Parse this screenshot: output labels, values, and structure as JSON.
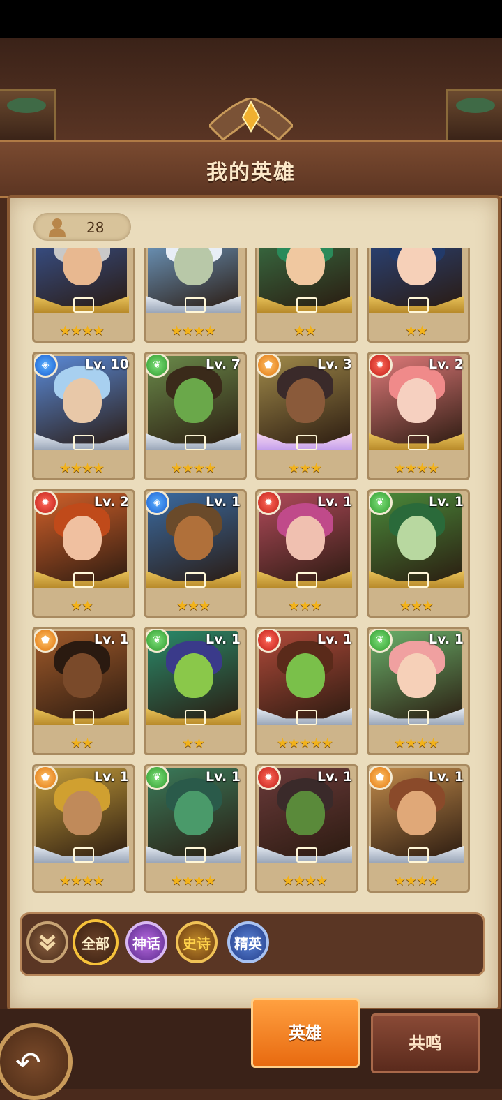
{
  "title": "我的英雄",
  "hero_count": "28",
  "filters": {
    "all": "全部",
    "mythic": "神话",
    "epic": "史诗",
    "elite": "精英"
  },
  "tabs": {
    "heroes": "英雄",
    "resonance": "共鸣"
  },
  "colors": {
    "accent_gold": "#f2b21a",
    "tab_active": "#f08020",
    "paper": "#eadcbc"
  },
  "heroes": [
    {
      "level": "",
      "element": "",
      "stars": "★★★★",
      "rarity": "gold"
    },
    {
      "level": "",
      "element": "",
      "stars": "★★★★",
      "rarity": "silver"
    },
    {
      "level": "",
      "element": "",
      "stars": "★★",
      "rarity": "gold"
    },
    {
      "level": "",
      "element": "",
      "stars": "★★",
      "rarity": "gold"
    },
    {
      "level": "Lv. 10",
      "element": "water",
      "stars": "★★★★",
      "rarity": "silver"
    },
    {
      "level": "Lv. 7",
      "element": "nature",
      "stars": "★★★★",
      "rarity": "silver"
    },
    {
      "level": "Lv. 3",
      "element": "light",
      "stars": "★★★",
      "rarity": "pink"
    },
    {
      "level": "Lv. 2",
      "element": "fire",
      "stars": "★★★★",
      "rarity": "gold"
    },
    {
      "level": "Lv. 2",
      "element": "fire",
      "stars": "★★",
      "rarity": "gold"
    },
    {
      "level": "Lv. 1",
      "element": "water",
      "stars": "★★★",
      "rarity": "gold"
    },
    {
      "level": "Lv. 1",
      "element": "fire",
      "stars": "★★★",
      "rarity": "gold"
    },
    {
      "level": "Lv. 1",
      "element": "nature",
      "stars": "★★★",
      "rarity": "gold"
    },
    {
      "level": "Lv. 1",
      "element": "light",
      "stars": "★★",
      "rarity": "gold"
    },
    {
      "level": "Lv. 1",
      "element": "nature",
      "stars": "★★",
      "rarity": "gold"
    },
    {
      "level": "Lv. 1",
      "element": "fire",
      "stars": "★★★★★",
      "rarity": "silver"
    },
    {
      "level": "Lv. 1",
      "element": "nature",
      "stars": "★★★★",
      "rarity": "silver"
    },
    {
      "level": "Lv. 1",
      "element": "light",
      "stars": "★★★★",
      "rarity": "silver"
    },
    {
      "level": "Lv. 1",
      "element": "nature",
      "stars": "★★★★",
      "rarity": "silver"
    },
    {
      "level": "Lv. 1",
      "element": "fire",
      "stars": "★★★★",
      "rarity": "silver"
    },
    {
      "level": "Lv. 1",
      "element": "light",
      "stars": "★★★★",
      "rarity": "silver"
    }
  ]
}
